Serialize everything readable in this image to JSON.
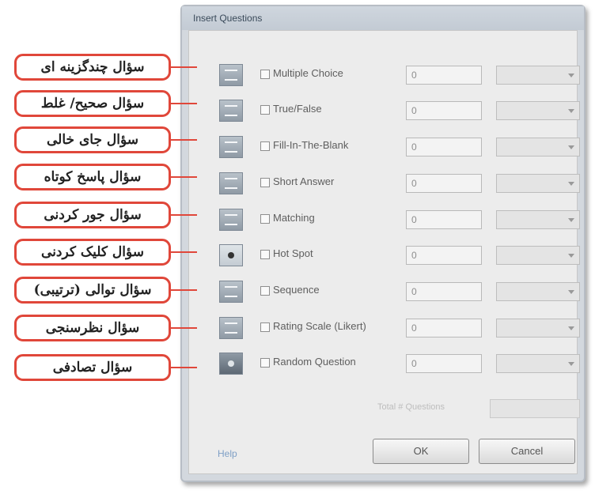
{
  "dialog": {
    "title": "Insert Questions",
    "help_label": "Help",
    "ok_label": "OK",
    "cancel_label": "Cancel",
    "total_label": "Total # Questions"
  },
  "rows": [
    {
      "label": "Multiple Choice",
      "count": "0",
      "checked": false,
      "icon": "multiple-choice-icon"
    },
    {
      "label": "True/False",
      "count": "0",
      "checked": false,
      "icon": "true-false-icon"
    },
    {
      "label": "Fill-In-The-Blank",
      "count": "0",
      "checked": false,
      "icon": "fill-in-blank-icon"
    },
    {
      "label": "Short Answer",
      "count": "0",
      "checked": false,
      "icon": "short-answer-icon"
    },
    {
      "label": "Matching",
      "count": "0",
      "checked": false,
      "icon": "matching-icon"
    },
    {
      "label": "Hot Spot",
      "count": "0",
      "checked": false,
      "icon": "hot-spot-icon"
    },
    {
      "label": "Sequence",
      "count": "0",
      "checked": false,
      "icon": "sequence-icon"
    },
    {
      "label": "Rating Scale (Likert)",
      "count": "0",
      "checked": false,
      "icon": "rating-scale-icon"
    },
    {
      "label": "Random Question",
      "count": "0",
      "checked": false,
      "icon": "random-question-icon"
    }
  ],
  "callouts": [
    "سؤال چندگزینه ای",
    "سؤال صحیح/ غلط",
    "سؤال جای خالی",
    "سؤال پاسخ کوتاه",
    "سؤال جور کردنی",
    "سؤال کلیک کردنی",
    "سؤال توالی (ترتیبی)",
    "سؤال نظرسنجی",
    "سؤال تصادفی"
  ],
  "colors": {
    "callout_border": "#e0473a",
    "dialog_bg": "#ececec",
    "help_link": "#7fa0c6"
  }
}
